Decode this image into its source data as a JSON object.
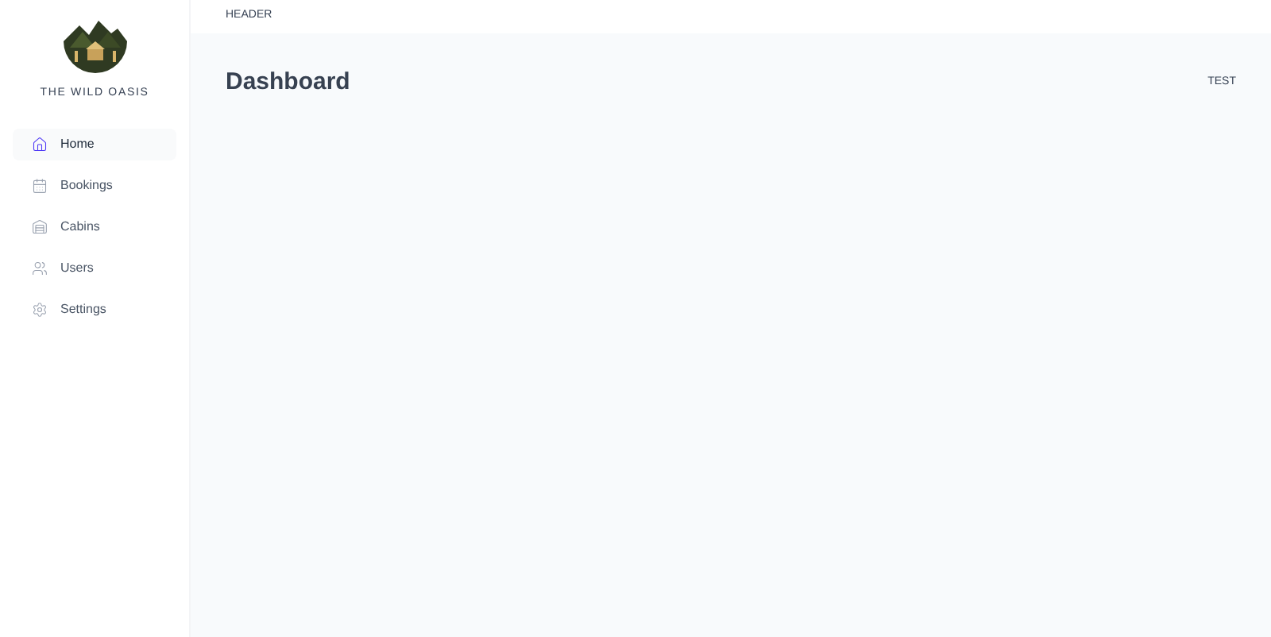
{
  "sidebar": {
    "brand": "THE WILD OASIS",
    "items": [
      {
        "label": "Home",
        "selected": true
      },
      {
        "label": "Bookings",
        "selected": false
      },
      {
        "label": "Cabins",
        "selected": false
      },
      {
        "label": "Users",
        "selected": false
      },
      {
        "label": "Settings",
        "selected": false
      }
    ]
  },
  "header": {
    "text": "HEADER"
  },
  "main": {
    "title": "Dashboard",
    "aside": "TEST"
  }
}
